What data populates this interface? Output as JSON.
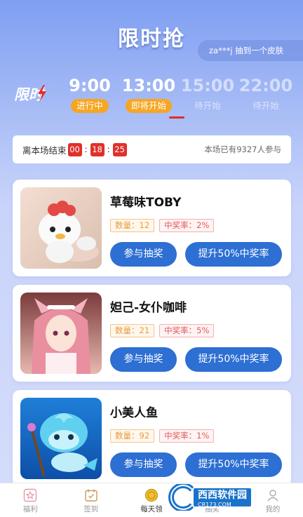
{
  "header": {
    "title": "限时抢",
    "ticker": "za***j 抽到一个皮肤",
    "logo_text": "限时"
  },
  "slots": [
    {
      "time": "9:00",
      "status": "进行中"
    },
    {
      "time": "13:00",
      "status": "即将开始"
    },
    {
      "time": "15:00",
      "status": "待开始"
    },
    {
      "time": "22:00",
      "status": "待开始"
    }
  ],
  "status_bar": {
    "label": "离本场结束",
    "hh": "00",
    "mm": "18",
    "ss": "25",
    "sep": ":",
    "participants": "本场已有9327人参与"
  },
  "items": [
    {
      "name": "草莓味TOBY",
      "qty": "数量：12",
      "rate": "中奖率：2%",
      "join": "参与抽奖",
      "boost": "提升50%中奖率"
    },
    {
      "name": "妲己-女仆咖啡",
      "qty": "数量：21",
      "rate": "中奖率：5%",
      "join": "参与抽奖",
      "boost": "提升50%中奖率"
    },
    {
      "name": "小美人鱼",
      "qty": "数量：92",
      "rate": "中奖率：1%",
      "join": "参与抽奖",
      "boost": "提升50%中奖率"
    }
  ],
  "tabs": [
    {
      "label": "福利",
      "icon": "star-icon"
    },
    {
      "label": "签到",
      "icon": "calendar-icon"
    },
    {
      "label": "每天领",
      "icon": "coin-icon"
    },
    {
      "label": "抽奖",
      "icon": "gift-icon"
    },
    {
      "label": "我的",
      "icon": "user-icon"
    }
  ],
  "watermark": {
    "main": "西西软件园",
    "sub": "CR173.COM"
  },
  "colors": {
    "accent": "#2d6fd3",
    "active_tag": "#f6a623",
    "countdown": "#e0302b"
  }
}
